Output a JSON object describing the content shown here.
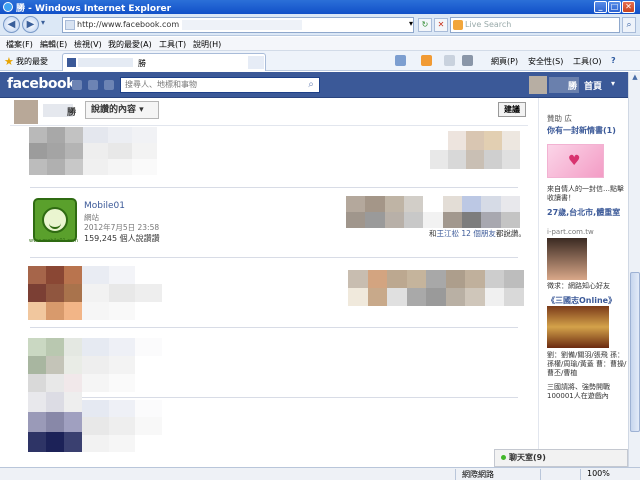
{
  "window": {
    "title": "勝 - Windows Internet Explorer",
    "minimize": "_",
    "maximize": "□",
    "close": "✕"
  },
  "address_bar": {
    "url": "http://www.facebook.com",
    "back": "◀",
    "forward": "▶",
    "refresh": "↻",
    "stop": "✕",
    "dropdown": "▾"
  },
  "search_box": {
    "placeholder": "Live Search",
    "go": "⌕"
  },
  "menu": {
    "file": "檔案(F)",
    "edit": "編輯(E)",
    "view": "檢視(V)",
    "favorites": "我的最愛(A)",
    "tools": "工具(T)",
    "help": "說明(H)"
  },
  "favorites_bar": {
    "label": "我的最愛",
    "tab_title": "勝"
  },
  "command_bar": {
    "page": "網頁(P)",
    "safety": "安全性(S)",
    "tools": "工具(O)",
    "help": "?"
  },
  "facebook_header": {
    "logo": "facebook",
    "search_placeholder": "搜尋人、地標和事物",
    "user_name": "勝",
    "home": "首頁",
    "menu_caret": "▾"
  },
  "page_header": {
    "title": "勝",
    "dropdown": "說讚的內容 ▾",
    "suggest_button": "建議"
  },
  "mobile01_card": {
    "name": "Mobile01",
    "type": "網站",
    "date": "2012年7月5日 23:58",
    "likes": "159,245 個人說讚讚",
    "logo_url": "www.mobile01.com",
    "friends_prefix": "和",
    "friends_name": "王江松",
    "friends_count": "12 個朋友",
    "friends_suffix": "都說讚。"
  },
  "right_column": {
    "sponsored": "贊助 広",
    "ad1": {
      "title": "你有一封新情書(1)",
      "text": "來自情人的一封信…點擊收讀書！"
    },
    "ad2": {
      "title": "27歲,台北市,體重室",
      "url": "i-part.com.tw",
      "text": "徵求：網路知心好友"
    },
    "ad3": {
      "title": "《三國志Online》",
      "text": "劉：劉備/關羽/張飛 孫：孫權/周瑜/黃蓋 曹：曹操/曹丕/曹植",
      "text2": "三國請將、強勢開戰 100001人在遊戲內"
    }
  },
  "chat": {
    "label": "聊天室(9)"
  },
  "status_bar": {
    "zone": "網際網路",
    "zoom": "100%"
  },
  "colors": {
    "fb_blue": "#3b5998",
    "ie_title": "#1150c8"
  }
}
